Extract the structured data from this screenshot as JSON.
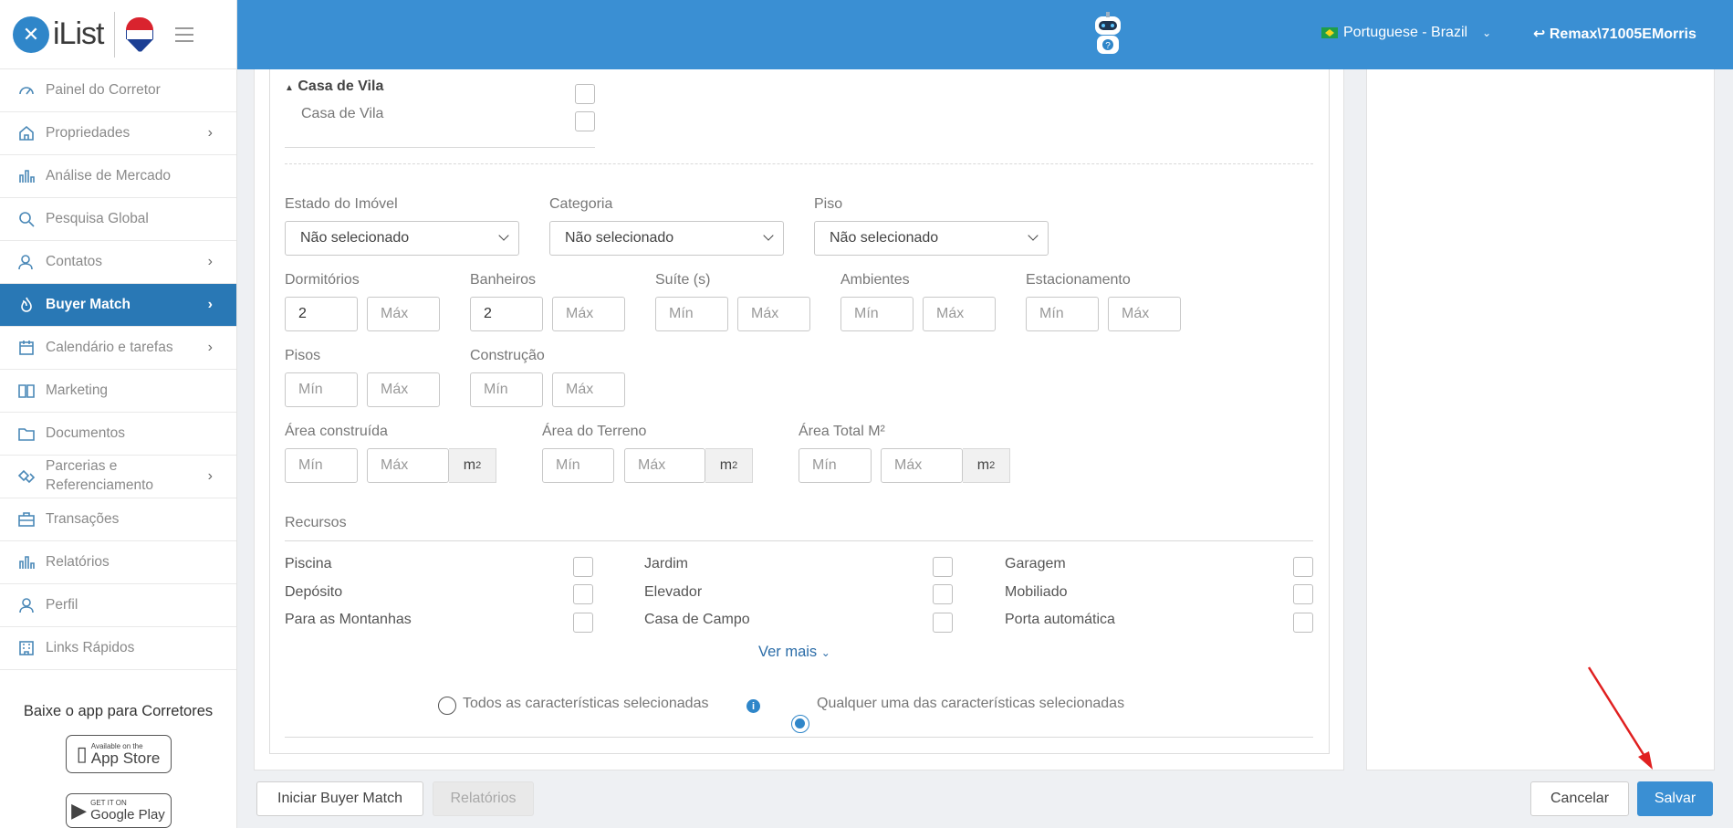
{
  "brand": {
    "name": "iList"
  },
  "sidebar": {
    "items": [
      {
        "label": "Painel do Corretor",
        "icon": "dashboard-icon",
        "chevron": false
      },
      {
        "label": "Propriedades",
        "icon": "home-icon",
        "chevron": true
      },
      {
        "label": "Análise de Mercado",
        "icon": "bar-chart-icon",
        "chevron": false
      },
      {
        "label": "Pesquisa Global",
        "icon": "search-icon",
        "chevron": false
      },
      {
        "label": "Contatos",
        "icon": "contacts-icon",
        "chevron": true
      },
      {
        "label": "Buyer Match",
        "icon": "flame-icon",
        "chevron": true,
        "active": true
      },
      {
        "label": "Calendário e tarefas",
        "icon": "calendar-icon",
        "chevron": true
      },
      {
        "label": "Marketing",
        "icon": "book-icon",
        "chevron": false
      },
      {
        "label": "Documentos",
        "icon": "folder-icon",
        "chevron": false
      },
      {
        "label": "Parcerias e Referenciamento",
        "icon": "handshake-icon",
        "chevron": true
      },
      {
        "label": "Transações",
        "icon": "briefcase-icon",
        "chevron": false
      },
      {
        "label": "Relatórios",
        "icon": "report-icon",
        "chevron": false
      },
      {
        "label": "Perfil",
        "icon": "user-icon",
        "chevron": false
      },
      {
        "label": "Links Rápidos",
        "icon": "building-icon",
        "chevron": false
      }
    ],
    "app_title": "Baixe o app para Corretores",
    "appstore": {
      "small": "Available on the",
      "big": "App Store"
    },
    "googleplay": {
      "small": "GET IT ON",
      "big": "Google Play"
    }
  },
  "header": {
    "language": "Portuguese - Brazil",
    "user": "Remax\\71005EMorris"
  },
  "form": {
    "casa_group": "Casa de Vila",
    "casa_item": "Casa de Vila",
    "estado": {
      "label": "Estado do Imóvel",
      "value": "Não selecionado"
    },
    "categoria": {
      "label": "Categoria",
      "value": "Não selecionado"
    },
    "piso": {
      "label": "Piso",
      "value": "Não selecionado"
    },
    "dormitorios": {
      "label": "Dormitórios",
      "min": "2",
      "max_ph": "Máx"
    },
    "banheiros": {
      "label": "Banheiros",
      "min": "2",
      "max_ph": "Máx"
    },
    "suites": {
      "label": "Suíte (s)",
      "min_ph": "Mín",
      "max_ph": "Máx"
    },
    "ambientes": {
      "label": "Ambientes",
      "min_ph": "Mín",
      "max_ph": "Máx"
    },
    "estacionamento": {
      "label": "Estacionamento",
      "min_ph": "Mín",
      "max_ph": "Máx"
    },
    "pisos": {
      "label": "Pisos",
      "min_ph": "Mín",
      "max_ph": "Máx"
    },
    "construcao": {
      "label": "Construção",
      "min_ph": "Mín",
      "max_ph": "Máx"
    },
    "area_construida": {
      "label": "Área construída",
      "min_ph": "Mín",
      "max_ph": "Máx",
      "unit": "m"
    },
    "area_terreno": {
      "label": "Área do Terreno",
      "min_ph": "Mín",
      "max_ph": "Máx",
      "unit": "m"
    },
    "area_total": {
      "label": "Área Total M²",
      "min_ph": "Mín",
      "max_ph": "Máx",
      "unit": "m"
    },
    "unit_sup": "2",
    "recursos_title": "Recursos",
    "recursos": [
      "Piscina",
      "Jardim",
      "Garagem",
      "Depósito",
      "Elevador",
      "Mobiliado",
      "Para as Montanhas",
      "Casa de Campo",
      "Porta automática"
    ],
    "ver_mais": "Ver mais",
    "radio_all": "Todos as características selecionadas",
    "radio_any": "Qualquer uma das características selecionadas",
    "info_glyph": "i"
  },
  "footer": {
    "iniciar": "Iniciar Buyer Match",
    "relatorios": "Relatórios",
    "cancelar": "Cancelar",
    "salvar": "Salvar"
  },
  "colors": {
    "header": "#3a8fd3",
    "active_nav": "#2978b5",
    "annotation_arrow": "#e02020"
  }
}
